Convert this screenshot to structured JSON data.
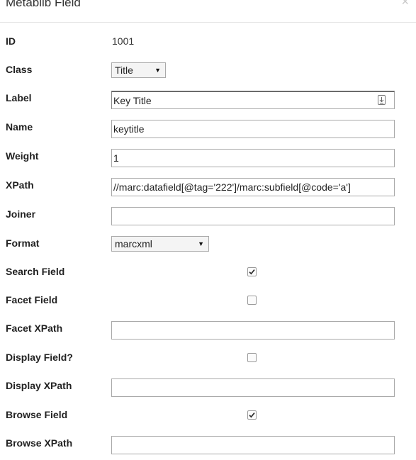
{
  "dialog": {
    "title": "Metablib Field",
    "close_glyph": "×"
  },
  "fields": {
    "id": {
      "label": "ID",
      "value": "1001"
    },
    "class": {
      "label": "Class",
      "selected": "Title"
    },
    "label": {
      "label": "Label",
      "value": "Key Title",
      "icon": "text-field-icon"
    },
    "name": {
      "label": "Name",
      "value": "keytitle"
    },
    "weight": {
      "label": "Weight",
      "value": "1"
    },
    "xpath": {
      "label": "XPath",
      "value": "//marc:datafield[@tag='222']/marc:subfield[@code='a']"
    },
    "joiner": {
      "label": "Joiner",
      "value": ""
    },
    "format": {
      "label": "Format",
      "selected": "marcxml"
    },
    "search_field": {
      "label": "Search Field",
      "checked": true
    },
    "facet_field": {
      "label": "Facet Field",
      "checked": false
    },
    "facet_xpath": {
      "label": "Facet XPath",
      "value": ""
    },
    "display_field": {
      "label": "Display Field?",
      "checked": false
    },
    "display_xpath": {
      "label": "Display XPath",
      "value": ""
    },
    "browse_field": {
      "label": "Browse Field",
      "checked": true
    },
    "browse_xpath": {
      "label": "Browse XPath",
      "value": ""
    }
  },
  "colors": {
    "border": "#a9a9a9",
    "check": "#333333"
  }
}
